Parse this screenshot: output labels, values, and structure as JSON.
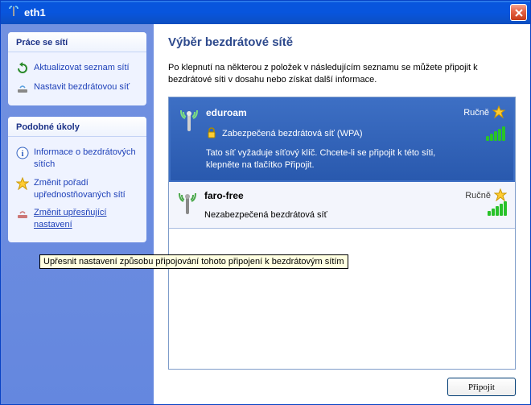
{
  "window": {
    "title": "eth1"
  },
  "sidebar": {
    "panel1": {
      "title": "Práce se sítí",
      "tasks": [
        {
          "label": "Aktualizovat seznam sítí"
        },
        {
          "label": "Nastavit bezdrátovou síť"
        }
      ]
    },
    "panel2": {
      "title": "Podobné úkoly",
      "tasks": [
        {
          "label": "Informace o bezdrátových sítích"
        },
        {
          "label": "Změnit pořadí upřednostňovaných sítí"
        },
        {
          "label": "Změnit upřesňující nastavení"
        }
      ]
    }
  },
  "main": {
    "heading": "Výběr bezdrátové sítě",
    "instruction": "Po klepnutí na některou z položek v následujícím seznamu se můžete připojit k bezdrátové síti v dosahu nebo získat další informace.",
    "networks": [
      {
        "name": "eduroam",
        "mode": "Ručně",
        "security": "Zabezpečená bezdrátová síť (WPA)",
        "description": "Tato síť vyžaduje síťový klíč. Chcete-li se připojit k této síti, klepněte na tlačítko Připojit.",
        "selected": true
      },
      {
        "name": "faro-free",
        "mode": "Ručně",
        "security": "Nezabezpečená bezdrátová síť",
        "selected": false
      }
    ],
    "connect_button": "Připojit"
  },
  "tooltip": "Upřesnit nastavení způsobu připojování tohoto připojení k bezdrátovým sítím"
}
